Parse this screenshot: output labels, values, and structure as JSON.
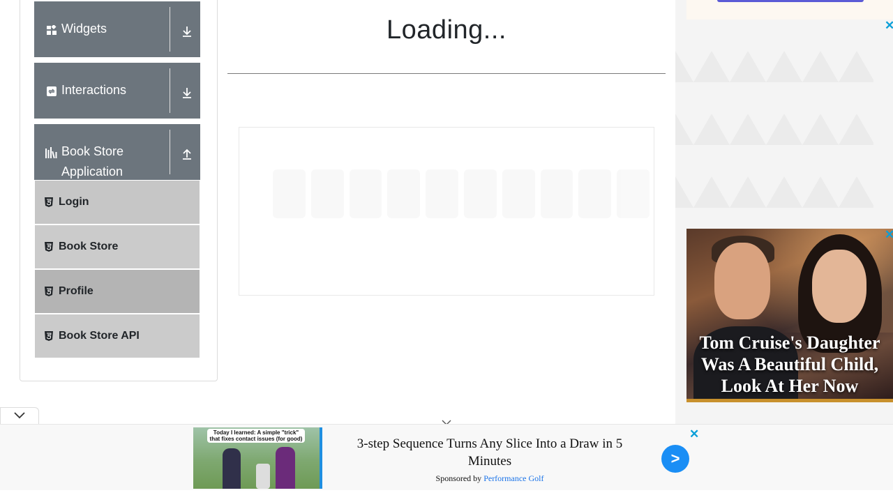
{
  "sidebar": {
    "groups": [
      {
        "label": "Widgets",
        "icon": "widgets-icon",
        "arrow": "download-arrow-icon"
      },
      {
        "label": "Interactions",
        "icon": "interactions-icon",
        "arrow": "download-arrow-icon"
      },
      {
        "label": "Book Store Application",
        "icon": "book-store-icon",
        "arrow": "upload-arrow-icon"
      }
    ],
    "items": [
      {
        "label": "Login",
        "icon": "html5-icon"
      },
      {
        "label": "Book Store",
        "icon": "html5-icon"
      },
      {
        "label": "Profile",
        "icon": "html5-icon"
      },
      {
        "label": "Book Store API",
        "icon": "html5-icon"
      }
    ]
  },
  "main": {
    "title": "Loading..."
  },
  "side_ad": {
    "caption": "Tom Cruise's Daughter Was A Beautiful Child, Look At Her Now",
    "close": "✕"
  },
  "top_ad": {
    "close": "✕"
  },
  "bottom_ad": {
    "thumb_text": "Today I learned: A simple \"trick\" that fixes contact issues (for good)",
    "headline": "3-step Sequence Turns Any Slice Into a Draw in 5 Minutes",
    "sponsored_prefix": "Sponsored by",
    "sponsor": "Performance Golf",
    "go_label": ">",
    "close": "✕"
  },
  "colors": {
    "group_header": "#6c757d",
    "item_bg": "#c6c6c6",
    "item_active": "#b4b4b4",
    "ad_close": "#0a9fd8",
    "sponsor_link": "#1a73e8",
    "go_button": "#1a8ef5"
  }
}
